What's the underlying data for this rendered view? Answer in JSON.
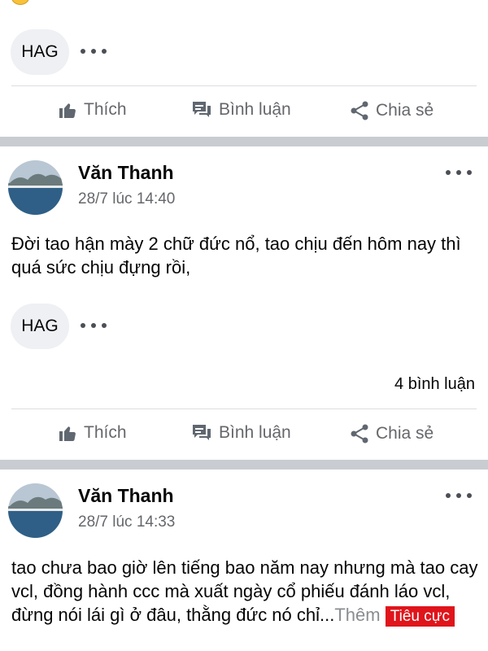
{
  "feed": {
    "top_post": {
      "tag_chip": "HAG",
      "actions": {
        "like": "Thích",
        "comment": "Bình luận",
        "share": "Chia sẻ"
      }
    },
    "posts": [
      {
        "author": "Văn Thanh",
        "timestamp": "28/7 lúc 14:40",
        "text": "Đời tao hận mày 2 chữ đức nổ, tao chịu đến hôm nay thì quá sức chịu đựng rồi,",
        "tag_chip": "HAG",
        "comment_count": "4 bình luận",
        "actions": {
          "like": "Thích",
          "comment": "Bình luận",
          "share": "Chia sẻ"
        }
      },
      {
        "author": "Văn Thanh",
        "timestamp": "28/7 lúc 14:33",
        "text": "tao chưa bao giờ lên tiếng bao năm nay nhưng mà tao cay vcl, đồng hành ccc mà xuất ngày cổ phiếu đánh láo vcl, đừng nói lái gì ở đâu, thằng đức nó chỉ...",
        "see_more": "Thêm",
        "sentiment_label": "Tiêu cực"
      }
    ]
  },
  "colors": {
    "separator": "#c9ccd1",
    "action_text": "#65676b",
    "sentiment_tag": "#e0141b"
  },
  "icons": [
    "like-icon",
    "comment-icon",
    "share-icon",
    "more-options-icon"
  ]
}
